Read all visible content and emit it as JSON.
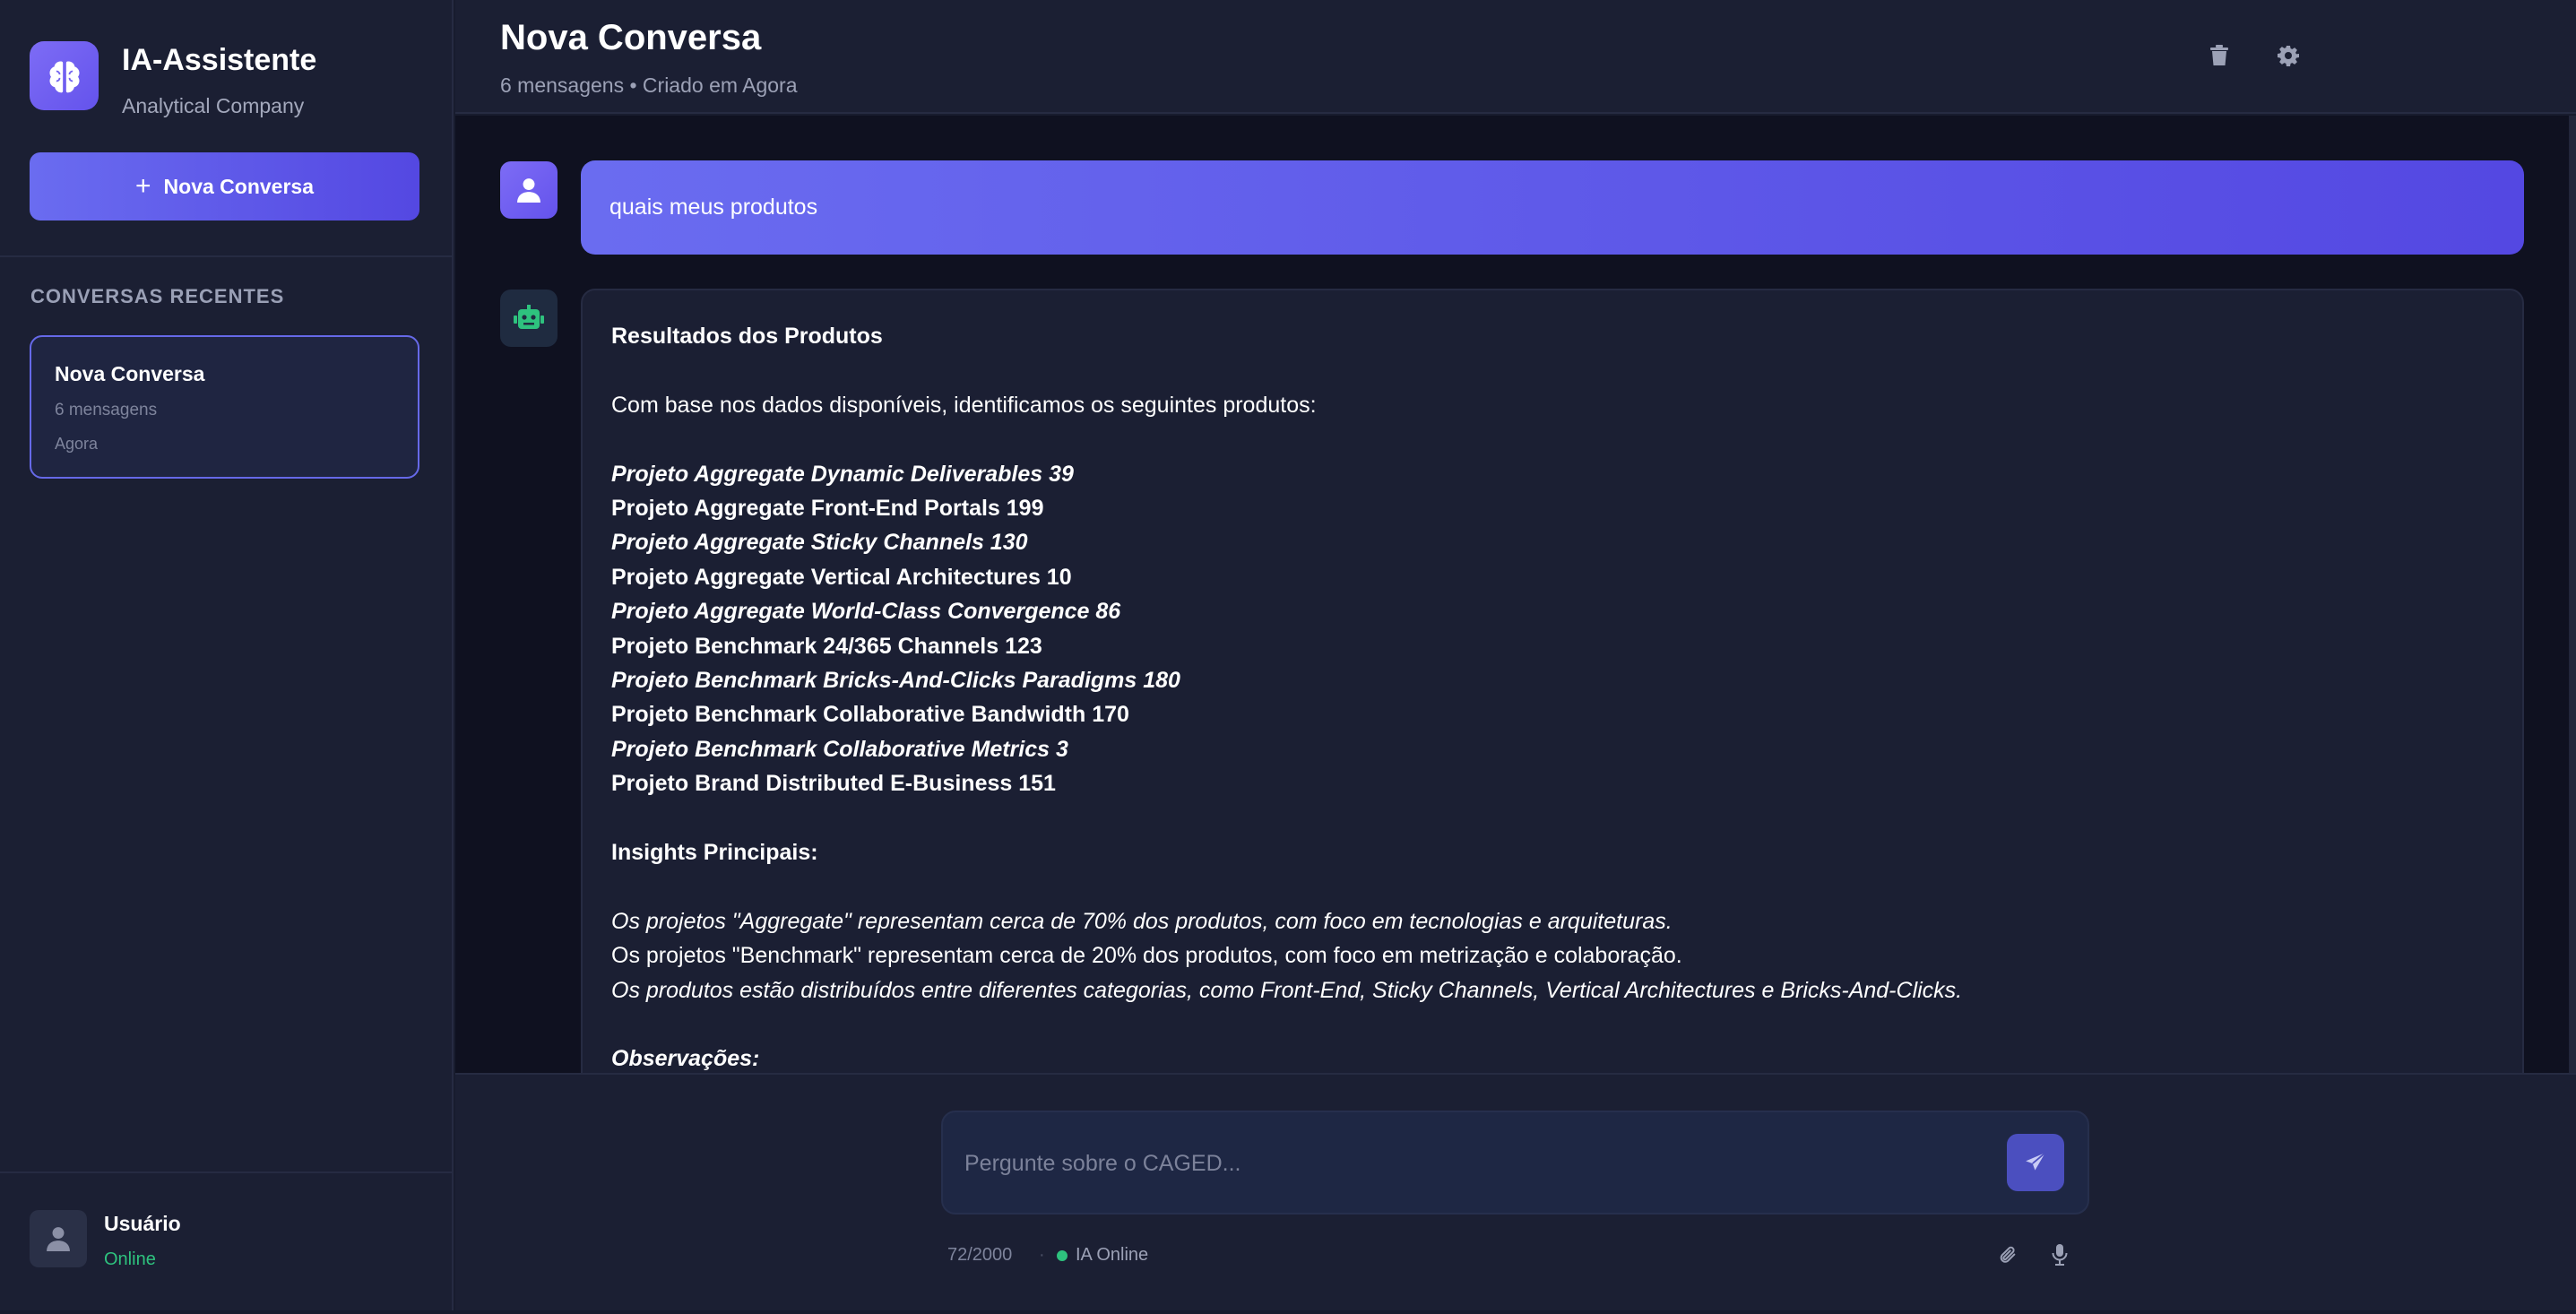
{
  "brand": {
    "title": "IA-Assistente",
    "subtitle": "Analytical Company",
    "icon": "brain-icon"
  },
  "sidebar": {
    "new_button_label": "Nova Conversa",
    "section_label": "CONVERSAS RECENTES",
    "conversations": [
      {
        "title": "Nova Conversa",
        "count": "6 mensagens",
        "time": "Agora"
      }
    ],
    "user": {
      "name": "Usuário",
      "status": "Online"
    }
  },
  "header": {
    "title": "Nova Conversa",
    "meta": "6 mensagens • Criado em Agora",
    "icons": [
      "trash-icon",
      "gear-icon"
    ]
  },
  "messages": {
    "user_message": "quais meus produtos",
    "bot_message": {
      "heading": "Resultados dos Produtos",
      "intro": "Com base nos dados disponíveis, identificamos os seguintes produtos:",
      "products": [
        {
          "text": "Projeto Aggregate Dynamic Deliverables 39",
          "italic": true
        },
        {
          "text": "Projeto Aggregate Front-End Portals 199",
          "italic": false
        },
        {
          "text": "Projeto Aggregate Sticky Channels 130",
          "italic": true
        },
        {
          "text": "Projeto Aggregate Vertical Architectures 10",
          "italic": false
        },
        {
          "text": "Projeto Aggregate World-Class Convergence 86",
          "italic": true
        },
        {
          "text": "Projeto Benchmark 24/365 Channels 123",
          "italic": false
        },
        {
          "text": "Projeto Benchmark Bricks-And-Clicks Paradigms 180",
          "italic": true
        },
        {
          "text": "Projeto Benchmark Collaborative Bandwidth 170",
          "italic": false
        },
        {
          "text": "Projeto Benchmark Collaborative Metrics 3",
          "italic": true
        },
        {
          "text": "Projeto Brand Distributed E-Business 151",
          "italic": false
        }
      ],
      "insights_heading": "Insights Principais:",
      "insights": [
        {
          "text": "Os projetos \"Aggregate\" representam cerca de 70% dos produtos, com foco em tecnologias e arquiteturas.",
          "italic": true
        },
        {
          "text": "Os projetos \"Benchmark\" representam cerca de 20% dos produtos, com foco em metrização e colaboração.",
          "italic": false
        },
        {
          "text": "Os produtos estão distribuídos entre diferentes categorias, como Front-End, Sticky Channels, Vertical Architectures e Bricks-And-Clicks.",
          "italic": true
        }
      ],
      "observations_heading": "Observações:"
    }
  },
  "composer": {
    "placeholder": "Pergunte sobre o CAGED...",
    "char_count": "72/2000",
    "separator": "·",
    "status": "IA Online"
  },
  "colors": {
    "accent": "#6366f1",
    "online": "#2ec27e",
    "sidebar_bg": "#1b1f33",
    "chat_bg": "#0f1120"
  }
}
